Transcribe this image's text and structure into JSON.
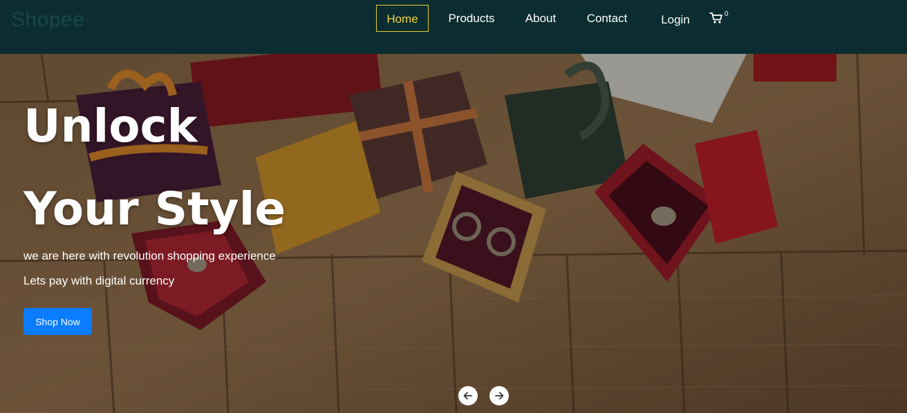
{
  "header": {
    "brand": "Shopee",
    "nav": [
      {
        "label": "Home",
        "active": true
      },
      {
        "label": "Products",
        "active": false
      },
      {
        "label": "About",
        "active": false
      },
      {
        "label": "Contact",
        "active": false
      },
      {
        "label": "Login",
        "active": false
      }
    ],
    "cart_count": "0",
    "cart_icon": "shopping-cart-icon"
  },
  "hero": {
    "headline_line1": "Unlock",
    "headline_line2": "Your Style",
    "subtext_line1": "we are here with revolution shopping experience",
    "subtext_line2": "Lets pay with digital currency",
    "cta_label": "Shop Now",
    "prev_icon": "arrow-left-icon",
    "next_icon": "arrow-right-icon"
  },
  "colors": {
    "navbar_bg": "#0b2d31",
    "active_nav_border": "#e4cf35",
    "active_nav_text": "#f1d43a",
    "cta_bg": "#0a7cff"
  }
}
